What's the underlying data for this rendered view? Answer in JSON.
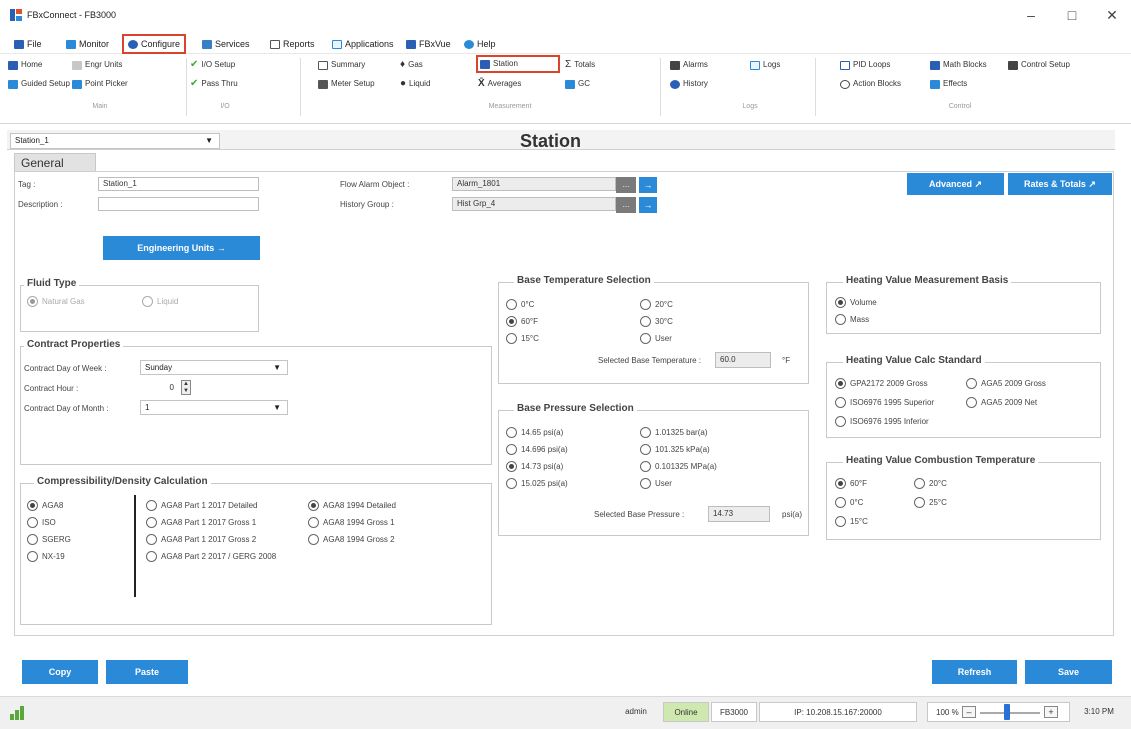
{
  "window": {
    "title": "FBxConnect - FB3000",
    "minimize": "–",
    "maximize": "□",
    "close": "✕"
  },
  "menu": [
    {
      "label": "File",
      "icon": "file-icon"
    },
    {
      "label": "Monitor",
      "icon": "monitor-icon"
    },
    {
      "label": "Configure",
      "icon": "configure-icon"
    },
    {
      "label": "Services",
      "icon": "services-icon"
    },
    {
      "label": "Reports",
      "icon": "reports-icon"
    },
    {
      "label": "Applications",
      "icon": "applications-icon"
    },
    {
      "label": "FBxVue",
      "icon": "fbxvue-icon"
    },
    {
      "label": "Help",
      "icon": "help-icon"
    }
  ],
  "ribbon": {
    "home": "Home",
    "guided_setup": "Guided Setup",
    "engr_units": "Engr Units",
    "point_picker": "Point Picker",
    "io_setup": "I/O Setup",
    "pass_thru": "Pass Thru",
    "summary": "Summary",
    "meter_setup": "Meter Setup",
    "gas": "Gas",
    "liquid": "Liquid",
    "station": "Station",
    "averages": "Averages",
    "totals": "Totals",
    "gc": "GC",
    "alarms": "Alarms",
    "history": "History",
    "logs": "Logs",
    "pid_loops": "PID Loops",
    "action_blocks": "Action Blocks",
    "math_blocks": "Math Blocks",
    "effects": "Effects",
    "control_setup": "Control Setup",
    "groups": {
      "main": "Main",
      "io": "I/O",
      "measurement": "Measurement",
      "logs": "Logs",
      "control": "Control"
    }
  },
  "station_select": "Station_1",
  "page_title": "Station",
  "tab_general": "General",
  "general": {
    "tag_label": "Tag :",
    "tag_value": "Station_1",
    "desc_label": "Description :",
    "desc_value": "",
    "flow_alarm_label": "Flow Alarm Object :",
    "flow_alarm_value": "Alarm_1801",
    "history_group_label": "History Group :",
    "history_group_value": "Hist Grp_4",
    "more": "...",
    "go": "→",
    "advanced": "Advanced ↗",
    "rates_totals": "Rates & Totals ↗",
    "engineering_units": "Engineering Units →"
  },
  "fluid_type": {
    "title": "Fluid Type",
    "natural_gas": "Natural Gas",
    "liquid": "Liquid"
  },
  "contract": {
    "title": "Contract Properties",
    "dow_label": "Contract Day of Week :",
    "dow_value": "Sunday",
    "hour_label": "Contract Hour :",
    "hour_value": "0",
    "dom_label": "Contract Day of Month :",
    "dom_value": "1"
  },
  "compressibility": {
    "title": "Compressibility/Density Calculation",
    "left": [
      "AGA8",
      "ISO",
      "SGERG",
      "NX-19"
    ],
    "mid": [
      "AGA8 Part 1 2017 Detailed",
      "AGA8 Part 1 2017 Gross 1",
      "AGA8 Part 1 2017 Gross 2",
      "AGA8 Part 2 2017 / GERG 2008"
    ],
    "right": [
      "AGA8 1994 Detailed",
      "AGA8 1994 Gross 1",
      "AGA8 1994 Gross 2"
    ]
  },
  "base_temp": {
    "title": "Base Temperature Selection",
    "left": [
      "0°C",
      "60°F",
      "15°C"
    ],
    "right": [
      "20°C",
      "30°C",
      "User"
    ],
    "selected_label": "Selected Base Temperature :",
    "selected_value": "60.0",
    "unit": "°F"
  },
  "base_pressure": {
    "title": "Base Pressure Selection",
    "left": [
      "14.65 psi(a)",
      "14.696 psi(a)",
      "14.73 psi(a)",
      "15.025 psi(a)"
    ],
    "right": [
      "1.01325 bar(a)",
      "101.325 kPa(a)",
      "0.101325 MPa(a)",
      "User"
    ],
    "selected_label": "Selected Base Pressure :",
    "selected_value": "14.73",
    "unit": "psi(a)"
  },
  "hv_basis": {
    "title": "Heating Value Measurement Basis",
    "options": [
      "Volume",
      "Mass"
    ]
  },
  "hv_std": {
    "title": "Heating Value Calc Standard",
    "options": [
      "GPA2172 2009 Gross",
      "AGA5 2009 Gross",
      "ISO6976 1995 Superior",
      "AGA5 2009 Net",
      "ISO6976 1995 Inferior"
    ]
  },
  "hv_temp": {
    "title": "Heating Value Combustion Temperature",
    "left": [
      "60°F",
      "0°C",
      "15°C"
    ],
    "right": [
      "20°C",
      "25°C"
    ]
  },
  "buttons": {
    "copy": "Copy",
    "paste": "Paste",
    "refresh": "Refresh",
    "save": "Save"
  },
  "status": {
    "user": "admin",
    "conn": "Online",
    "device": "FB3000",
    "ip": "IP: 10.208.15.167:20000",
    "zoom": "100 %",
    "minus": "–",
    "plus": "+",
    "time": "3:10 PM",
    "zoom_level": 0.45
  },
  "colors": {
    "accent": "#2b8ad8",
    "highlight": "#d9442d",
    "online": "#cfe8b0"
  }
}
